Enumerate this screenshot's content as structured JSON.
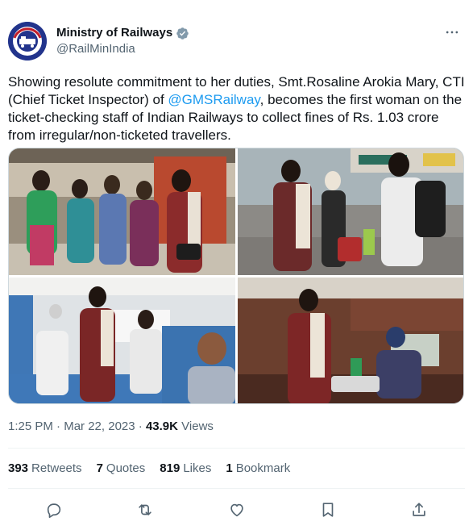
{
  "author": {
    "display_name": "Ministry of Railways",
    "handle": "@RailMinIndia",
    "avatar_text": "INDIAN RAILWAYS"
  },
  "tweet": {
    "text_before_mention": "Showing resolute commitment to her duties, Smt.Rosaline Arokia Mary, CTI (Chief Ticket Inspector) of ",
    "mention": "@GMSRailway",
    "text_after_mention": ", becomes the first woman on the ticket-checking staff of Indian Railways to collect fines of Rs. 1.03 crore from irregular/non-ticketed travellers."
  },
  "meta": {
    "time": "1:25 PM",
    "separator": " · ",
    "date": "Mar 22, 2023",
    "views_count": "43.9K",
    "views_label": "Views"
  },
  "stats": {
    "retweets_count": "393",
    "retweets_label": "Retweets",
    "quotes_count": "7",
    "quotes_label": "Quotes",
    "likes_count": "819",
    "likes_label": "Likes",
    "bookmarks_count": "1",
    "bookmarks_label": "Bookmark"
  },
  "icons": {
    "more": "more-icon",
    "verified": "verified-badge-icon",
    "reply": "reply-icon",
    "retweet": "retweet-icon",
    "like": "like-icon",
    "bookmark": "bookmark-icon",
    "share": "share-icon"
  },
  "colors": {
    "accent": "#1d9bf0",
    "text": "#0f1419",
    "secondary": "#536471",
    "border": "#cfd9de"
  }
}
